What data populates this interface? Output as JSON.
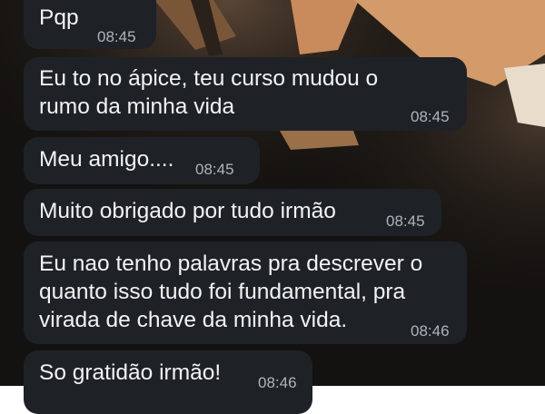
{
  "messages": [
    {
      "text": "Pqp",
      "time": "08:45"
    },
    {
      "text": "Eu to no ápice, teu curso mudou o\nrumo da minha vida",
      "time": "08:45"
    },
    {
      "text": "Meu amigo....",
      "time": "08:45"
    },
    {
      "text": "Muito obrigado por tudo irmão",
      "time": "08:45"
    },
    {
      "text": "Eu nao tenho palavras pra descrever o\nquanto isso tudo foi fundamental, pra\nvirada de chave da minha vida.",
      "time": "08:46"
    },
    {
      "text": "So gratidão irmão!",
      "time": "08:46"
    }
  ],
  "colors": {
    "bubble": "#1e2226",
    "text": "#f1f3f5",
    "timestamp": "#aeb4bb",
    "background": "#141210"
  }
}
